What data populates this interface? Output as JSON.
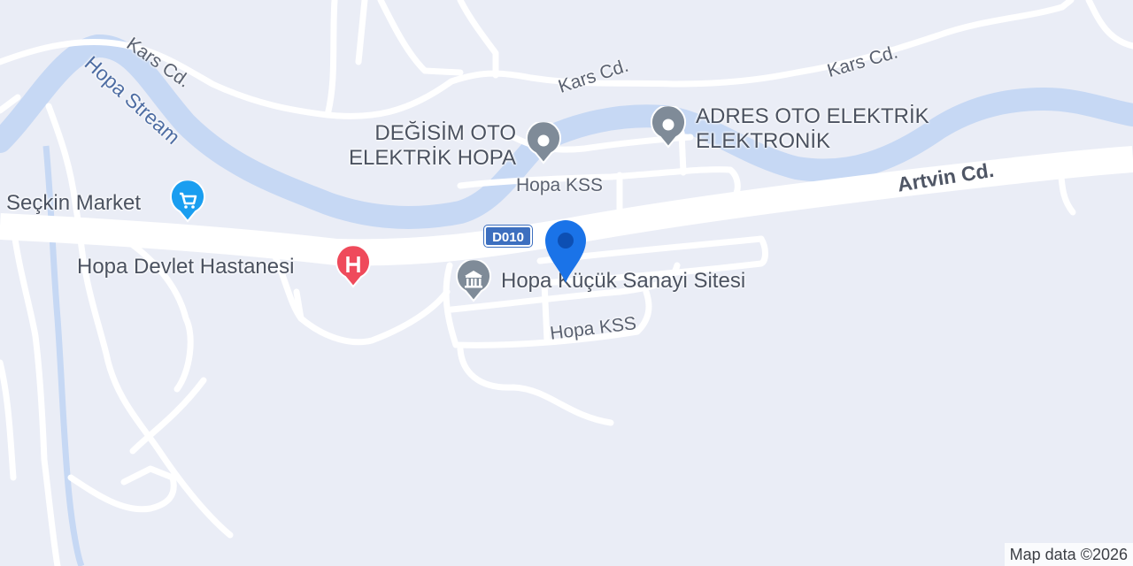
{
  "map": {
    "roads": {
      "kars_left": "Kars Cd.",
      "kars_mid": "Kars Cd.",
      "kars_right": "Kars Cd.",
      "artvin": "Artvin Cd.",
      "kss_top": "Hopa KSS",
      "kss_bottom": "Hopa KSS"
    },
    "water": {
      "stream": "Hopa Stream"
    },
    "route_shield": "D010",
    "pois": [
      {
        "label": "Seçkin Market",
        "icon": "shopping-cart-icon",
        "color": "#1a9ef0"
      },
      {
        "label": "Hopa Devlet Hastanesi",
        "icon": "hospital-icon",
        "color": "#ef4a5b"
      },
      {
        "label": "Hopa Küçük Sanayi Sitesi",
        "icon": "building-icon",
        "color": "#7f8b98"
      },
      {
        "label_line1": "DEĞİSİM OTO",
        "label_line2": "ELEKTRİK HOPA",
        "icon": "place-icon",
        "color": "#7f8b98"
      },
      {
        "label_line1": "ADRES OTO ELEKTRİK",
        "label_line2": "ELEKTRONİK",
        "icon": "place-icon",
        "color": "#7f8b98"
      }
    ],
    "marker": {
      "icon": "location-pin-icon",
      "color": "#1a73e8"
    },
    "attribution": "Map data ©2026"
  }
}
